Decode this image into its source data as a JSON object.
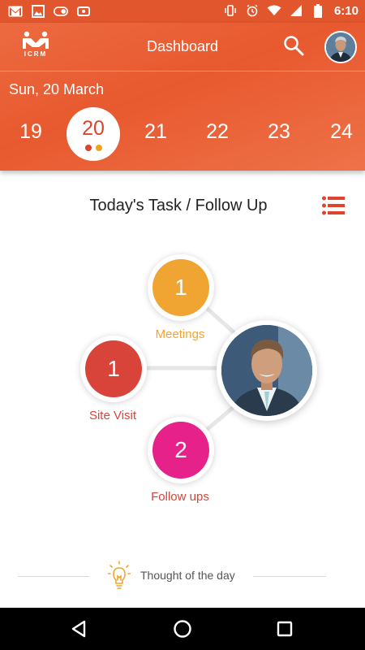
{
  "status_bar": {
    "time": "6:10",
    "left_icons": [
      "gmail-icon",
      "gallery-icon",
      "toggle-icon",
      "settings-icon"
    ],
    "right_icons": [
      "vibrate-icon",
      "alarm-icon",
      "wifi-icon",
      "signal-icon",
      "battery-icon"
    ]
  },
  "header": {
    "logo_text": "ICRM",
    "title": "Dashboard",
    "date_label": "Sun, 20 March",
    "days": [
      "19",
      "20",
      "21",
      "22",
      "23",
      "24"
    ],
    "selected_day": "20",
    "dot_colors": [
      "#d9442a",
      "#f0a21e"
    ],
    "accent": "#e8592f"
  },
  "main": {
    "section_title": "Today's Task / Follow Up",
    "tasks": [
      {
        "count": "1",
        "label": "Meetings",
        "color": "#f0a532"
      },
      {
        "count": "1",
        "label": "Site Visit",
        "color": "#d8443a"
      },
      {
        "count": "2",
        "label": "Follow ups",
        "color": "#e6228a"
      }
    ],
    "thought": "Thought of the day"
  },
  "nav": {
    "buttons": [
      "back-icon",
      "home-icon",
      "recents-icon"
    ]
  }
}
